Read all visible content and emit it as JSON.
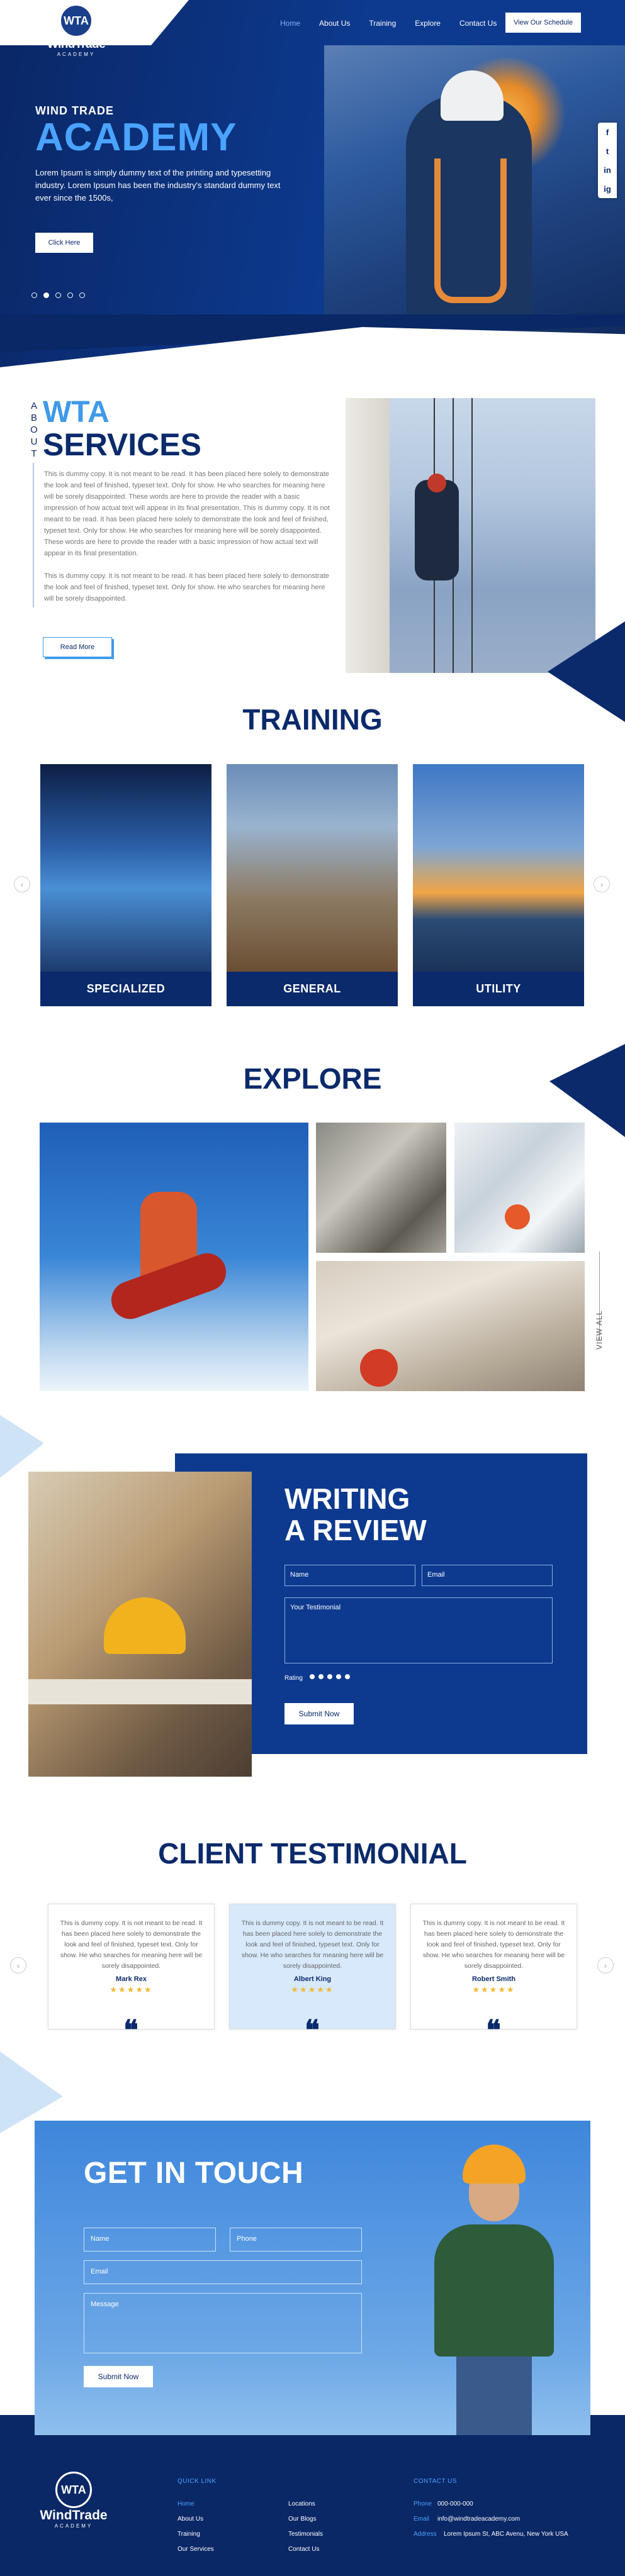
{
  "brand": {
    "logo_mark": "WTA",
    "name": "WindTrade",
    "sub": "ACADEMY"
  },
  "nav": {
    "items": [
      {
        "label": "Home",
        "active": true
      },
      {
        "label": "About Us"
      },
      {
        "label": "Training"
      },
      {
        "label": "Explore"
      },
      {
        "label": "Contact Us"
      }
    ],
    "cta": "View Our Schedule"
  },
  "hero": {
    "kicker": "WIND TRADE",
    "title": "ACADEMY",
    "text": "Lorem Ipsum is simply dummy text of the printing and typesetting industry. Lorem Ipsum has been the industry's standard dummy text ever since the 1500s,",
    "button": "Click Here",
    "slides": 5,
    "active_slide": 2
  },
  "social": [
    "f",
    "t",
    "in",
    "ig"
  ],
  "about": {
    "vertical": "ABOUT",
    "title1": "WTA",
    "title2": "SERVICES",
    "p1": "This is dummy copy. It is not meant to be read. It has been placed here solely to demonstrate the look and feel of finished, typeset text. Only for show. He who searches for meaning here will be sorely disappointed. These words are here to provide the reader with a basic impression of how actual text will appear in its final presentation. This is dummy copy. It is not meant to be read. It has been placed here solely to demonstrate the look and feel of finished, typeset text. Only for show. He who searches for meaning here will be sorely disappointed. These words are here to provide the reader with a basic impression of how actual text will appear in its final presentation.",
    "p2": "This is dummy copy. It is not meant to be read. It has been placed here solely to demonstrate the look and feel of finished, typeset text. Only for show. He who searches for meaning here will be sorely disappointed.",
    "button": "Read More"
  },
  "training": {
    "title": "TRAINING",
    "cards": [
      {
        "label": "SPECIALIZED"
      },
      {
        "label": "GENERAL"
      },
      {
        "label": "UTILITY"
      }
    ],
    "prev": "‹",
    "next": "›"
  },
  "explore": {
    "title": "EXPLORE",
    "view_all": "VIEW ALL"
  },
  "review": {
    "title_line1": "WRITING",
    "title_line2": "A REVIEW",
    "name_ph": "Name",
    "email_ph": "Email",
    "testimonial_ph": "Your Testimonial",
    "rating_label": "Rating",
    "button": "Submit Now"
  },
  "testimonials": {
    "title": "CLIENT TESTIMONIAL",
    "items": [
      {
        "text": "This is dummy copy. It is not meant to be read. It has been placed here solely to demonstrate the look and feel of finished, typeset text. Only for show. He who searches for meaning here will be sorely disappointed.",
        "name": "Mark Rex",
        "stars": "★★★★★"
      },
      {
        "text": "This is dummy copy. It is not meant to be read. It has been placed here solely to demonstrate the look and feel of finished, typeset text. Only for show. He who searches for meaning here will be sorely disappointed.",
        "name": "Albert King",
        "stars": "★★★★★"
      },
      {
        "text": "This is dummy copy. It is not meant to be read. It has been placed here solely to demonstrate the look and feel of finished, typeset text. Only for show. He who searches for meaning here will be sorely disappointed.",
        "name": "Robert Smith",
        "stars": "★★★★★"
      }
    ],
    "quote": "❝",
    "prev": "‹",
    "next": "›"
  },
  "contact": {
    "title": "GET IN TOUCH",
    "name_ph": "Name",
    "phone_ph": "Phone",
    "email_ph": "Email",
    "message_ph": "Message",
    "button": "Submit Now"
  },
  "footer": {
    "quick_link_head": "QUICK LINK",
    "contact_head": "CONTACT US",
    "col1": [
      "Home",
      "About Us",
      "Training",
      "Our Services"
    ],
    "col2": [
      "Locations",
      "Our Blogs",
      "Testimonials",
      "Contact Us"
    ],
    "phone_label": "Phone",
    "phone": "000-000-000",
    "email_label": "Email",
    "email": "info@windtradeacademy.com",
    "address_label": "Address",
    "address": "Lorem Ipsum St, ABC Avenu, New York USA"
  },
  "colors": {
    "navy": "#0b2a6b",
    "accent": "#3f9ae8",
    "light": "#d7e9fb",
    "star": "#f5b82e"
  }
}
